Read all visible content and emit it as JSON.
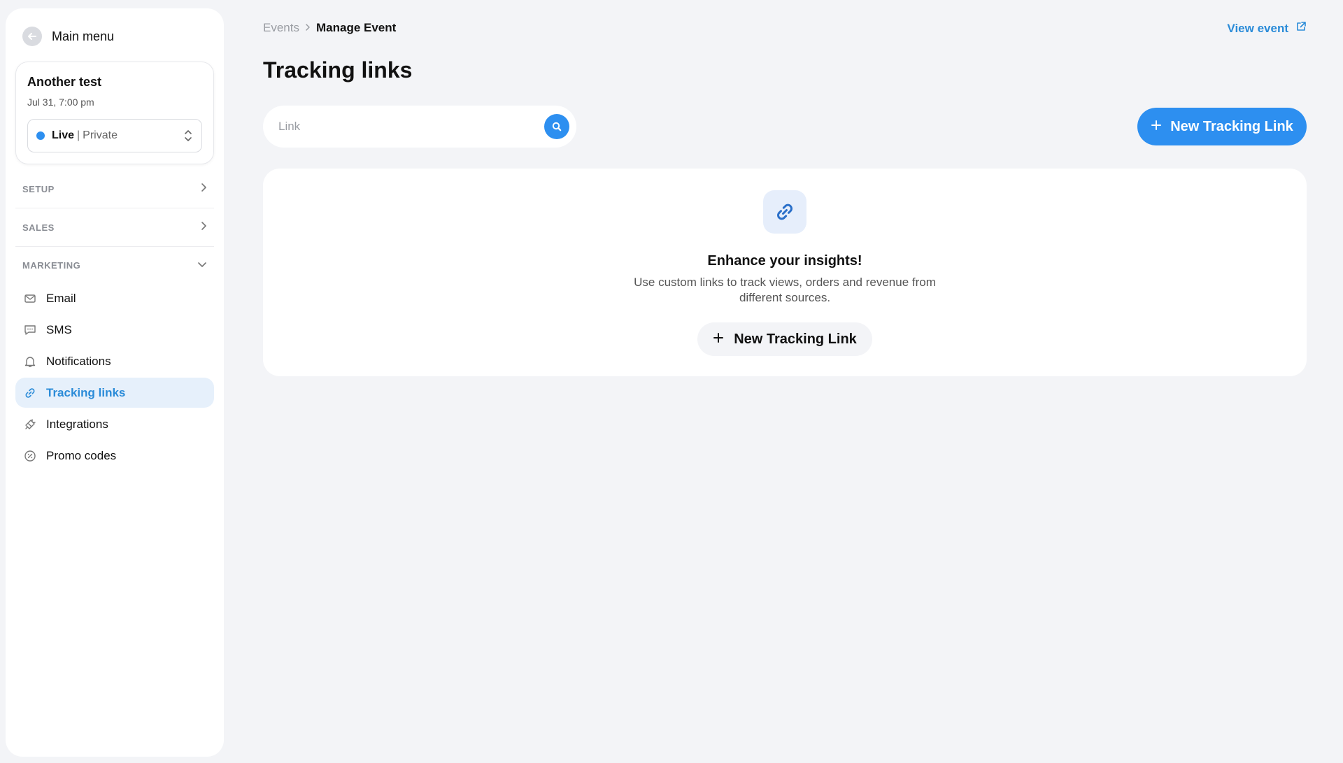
{
  "sidebar": {
    "main_menu": "Main menu",
    "event": {
      "name": "Another test",
      "date": "Jul 31, 7:00 pm",
      "status": "Live",
      "separator": "|",
      "visibility": "Private"
    },
    "sections": {
      "setup": "SETUP",
      "sales": "SALES",
      "marketing": "MARKETING"
    },
    "items": [
      {
        "label": "Email",
        "icon": "mail-icon"
      },
      {
        "label": "SMS",
        "icon": "chat-icon"
      },
      {
        "label": "Notifications",
        "icon": "bell-icon"
      },
      {
        "label": "Tracking links",
        "icon": "link-icon",
        "active": true
      },
      {
        "label": "Integrations",
        "icon": "plug-icon"
      },
      {
        "label": "Promo codes",
        "icon": "discount-badge-icon"
      }
    ]
  },
  "header": {
    "breadcrumb_root": "Events",
    "breadcrumb_current": "Manage Event",
    "view_event": "View event",
    "title": "Tracking links"
  },
  "search": {
    "placeholder": "Link",
    "value": ""
  },
  "toolbar": {
    "new_link": "New Tracking Link"
  },
  "empty_state": {
    "title": "Enhance your insights!",
    "description": "Use custom links to track views, orders and revenue from different sources.",
    "button": "New Tracking Link"
  },
  "colors": {
    "accent": "#2d8ff0",
    "active_bg": "#e6f0fb",
    "page_bg": "#f3f4f7"
  }
}
